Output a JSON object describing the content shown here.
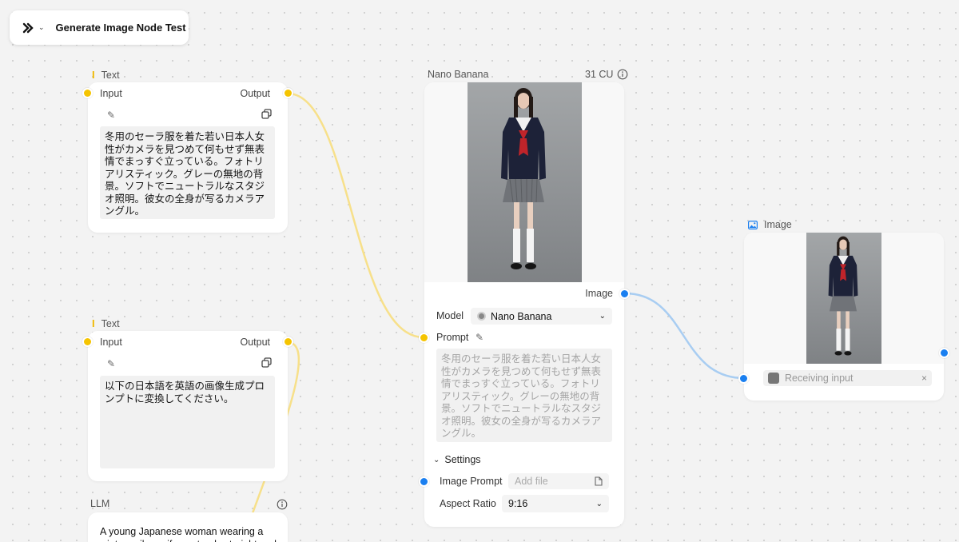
{
  "project": {
    "title": "Generate Image Node Test"
  },
  "text_node_1": {
    "label": "Text",
    "input_label": "Input",
    "output_label": "Output",
    "content": "冬用のセーラ服を着た若い日本人女性がカメラを見つめて何もせず無表情でまっすぐ立っている。フォトリアリスティック。グレーの無地の背景。ソフトでニュートラルなスタジオ照明。彼女の全身が写るカメラアングル。"
  },
  "text_node_2": {
    "label": "Text",
    "input_label": "Input",
    "output_label": "Output",
    "content": "以下の日本語を英語の画像生成プロンプトに変換してください。"
  },
  "llm_node": {
    "label": "LLM",
    "content": "A young Japanese woman wearing a winter sailor uniform stands straight and"
  },
  "nano_node": {
    "label": "Nano Banana",
    "cost": "31 CU",
    "image_output_label": "Image",
    "model_label": "Model",
    "model_value": "Nano Banana",
    "prompt_label": "Prompt",
    "prompt_text": "冬用のセーラ服を着た若い日本人女性がカメラを見つめて何もせず無表情でまっすぐ立っている。フォトリアリスティック。グレーの無地の背景。ソフトでニュートラルなスタジオ照明。彼女の全身が写るカメラアングル。",
    "settings_label": "Settings",
    "image_prompt_label": "Image Prompt",
    "image_prompt_placeholder": "Add file",
    "aspect_ratio_label": "Aspect Ratio",
    "aspect_ratio_value": "9:16"
  },
  "image_node": {
    "label": "Image",
    "receiving_text": "Receiving input"
  },
  "colors": {
    "port_yellow": "#f5c400",
    "port_blue": "#1a7ff0",
    "wire_yellow": "#f7e08a",
    "wire_blue": "#a8cdf2"
  }
}
